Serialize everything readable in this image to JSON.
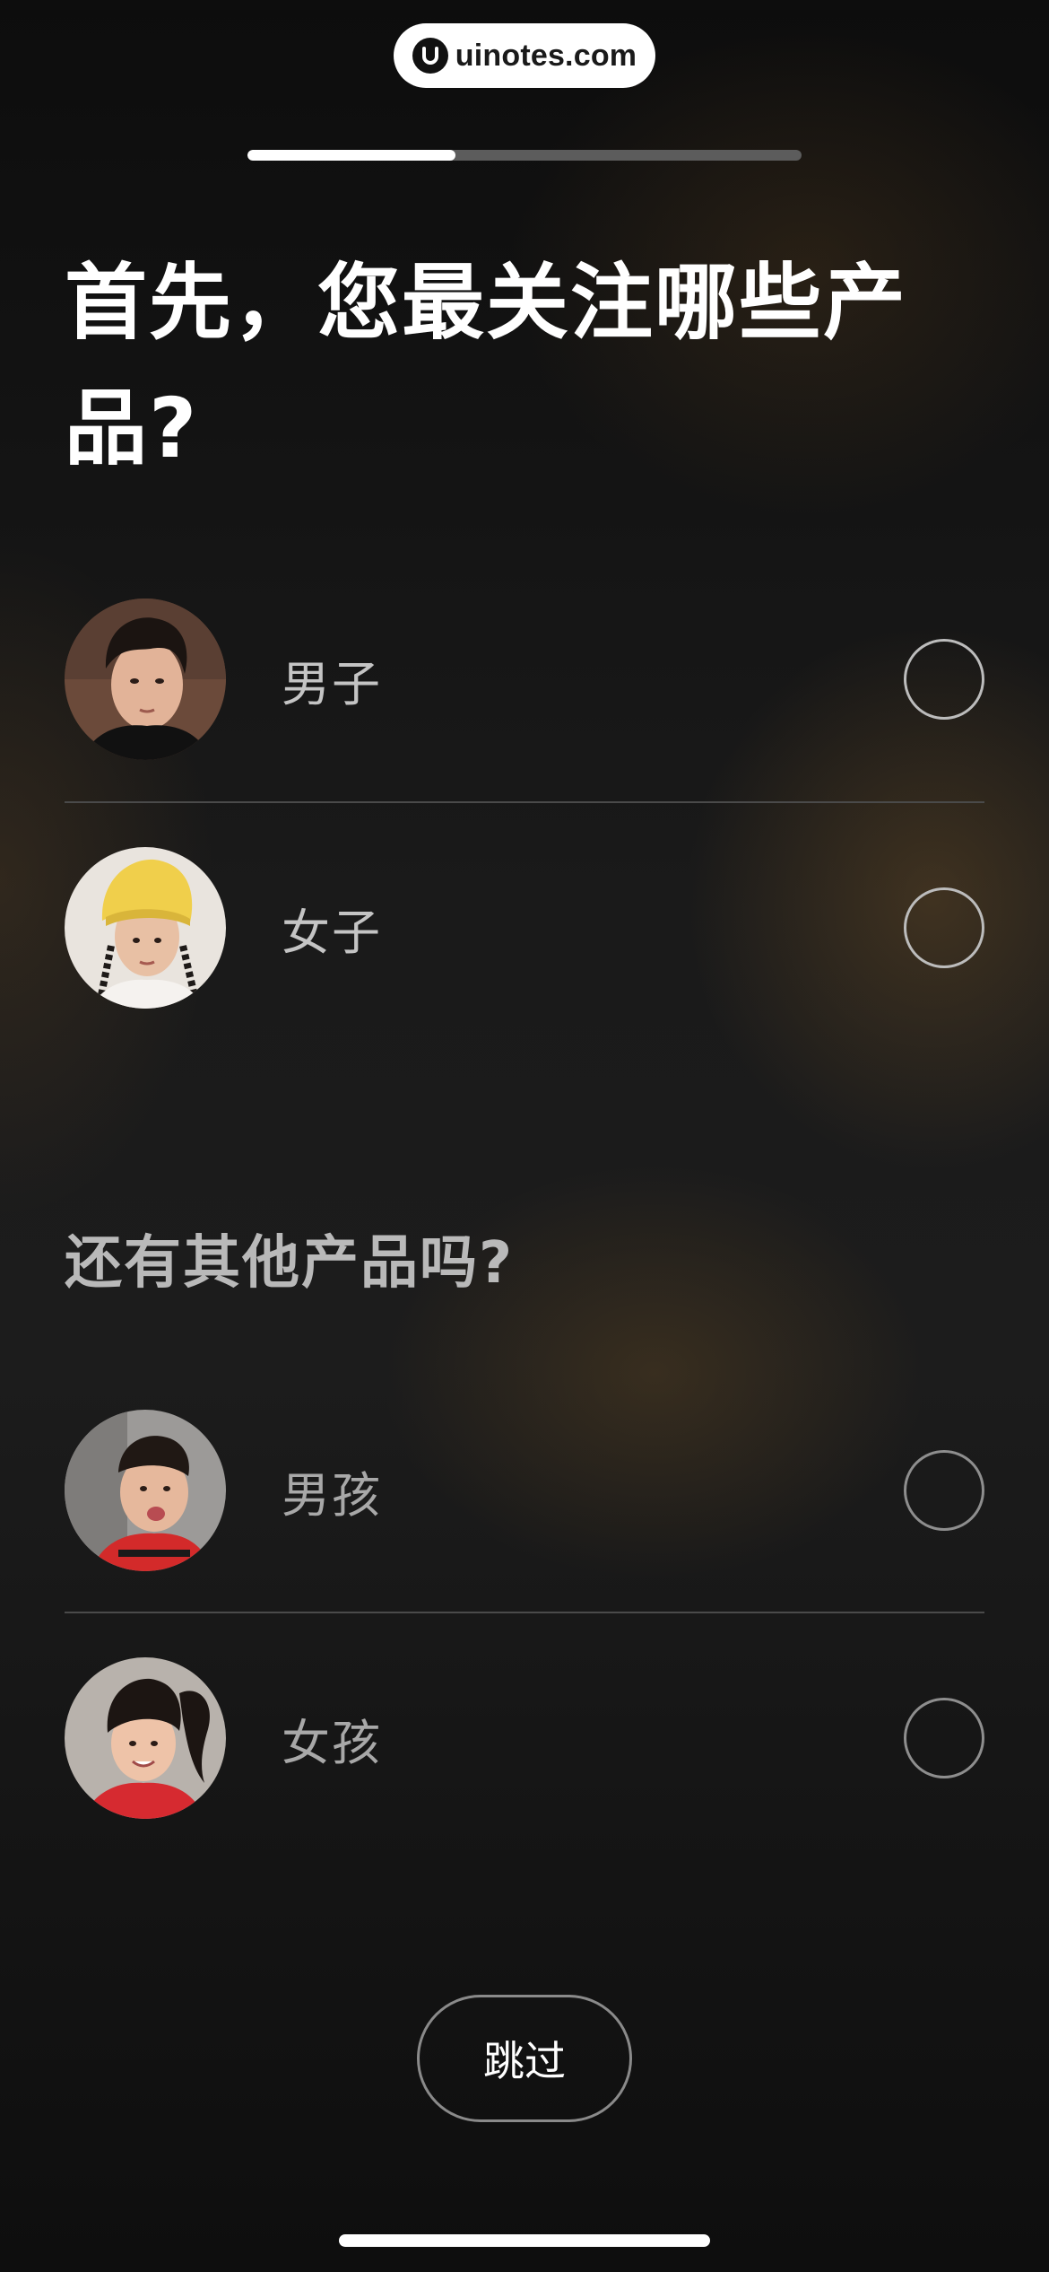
{
  "watermark": {
    "text": "uinotes.com",
    "icon": "uinotes-logo-icon"
  },
  "progress": {
    "fraction": 0.375
  },
  "heading": "首先，您最关注哪些产品?",
  "primary_options": [
    {
      "label": "男子",
      "avatar": "man-avatar"
    },
    {
      "label": "女子",
      "avatar": "woman-avatar"
    }
  ],
  "subheading": "还有其他产品吗?",
  "secondary_options": [
    {
      "label": "男孩",
      "avatar": "boy-avatar"
    },
    {
      "label": "女孩",
      "avatar": "girl-avatar"
    }
  ],
  "skip_button": {
    "label": "跳过"
  },
  "colors": {
    "background": "#131313",
    "accent_warm": "#6e5028",
    "text_primary": "#ffffff",
    "text_secondary": "#c4c4c4",
    "progress_track": "#5c5c5c"
  }
}
